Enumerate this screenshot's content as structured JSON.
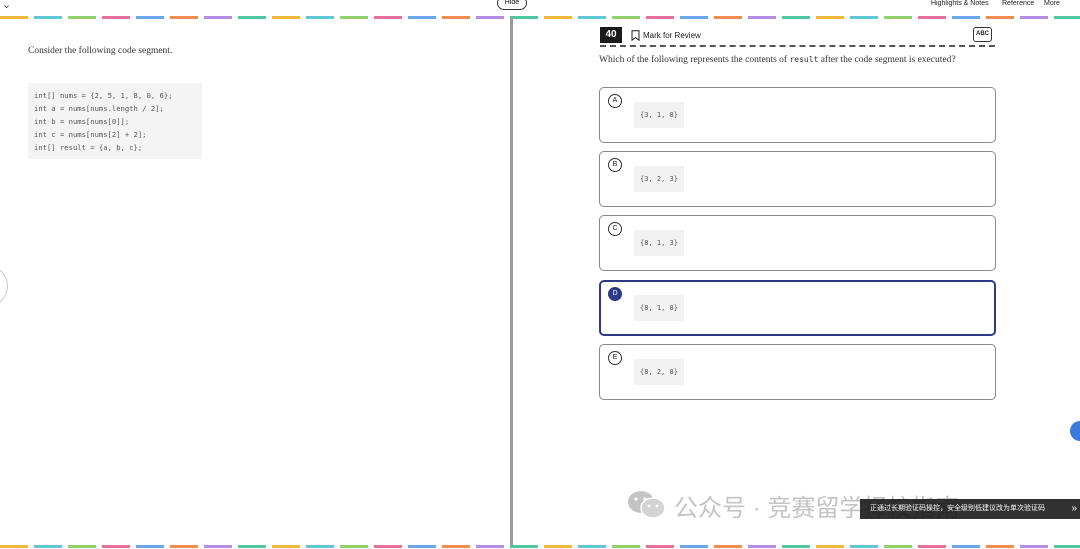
{
  "toolbar": {
    "hide_label": "Hide",
    "highlights_label": "Highlights & Notes",
    "reference_label": "Reference",
    "more_label": "More"
  },
  "colors": {
    "dashes": [
      "#f2b83a",
      "#5fc7d9",
      "#8fd16b",
      "#e96f9f",
      "#6aa7ef",
      "#f58b4c",
      "#b58ce6",
      "#4fc7a0"
    ],
    "selected_option": "#2e3a87"
  },
  "passage": {
    "intro": "Consider the following code segment.",
    "code_lines": [
      "int[] nums = {2, 5, 1, 8, 0, 6};",
      "int a = nums[nums.length / 2];",
      "int b = nums[nums[0]];",
      "int c = nums[nums[2] + 2];",
      "int[] result = {a, b, c};"
    ]
  },
  "question": {
    "number": "40",
    "mark_label": "Mark for Review",
    "abc_label": "ABC",
    "text_before": "Which of the following represents the contents of ",
    "code_term": "result",
    "text_after": " after the code segment is executed?"
  },
  "options": [
    {
      "letter": "A",
      "code": "{3, 1, 8}"
    },
    {
      "letter": "B",
      "code": "{3, 2, 3}"
    },
    {
      "letter": "C",
      "code": "{8, 1, 3}"
    },
    {
      "letter": "D",
      "code": "{8, 1, 8}"
    },
    {
      "letter": "E",
      "code": "{8, 2, 8}"
    }
  ],
  "selected_option": "D",
  "watermark": {
    "text": "公众号 · 竞赛留学择校指南"
  },
  "toast": {
    "text": "正通过长期验证码操控，安全级别低建议改为单次验证码",
    "arrow": "»"
  }
}
